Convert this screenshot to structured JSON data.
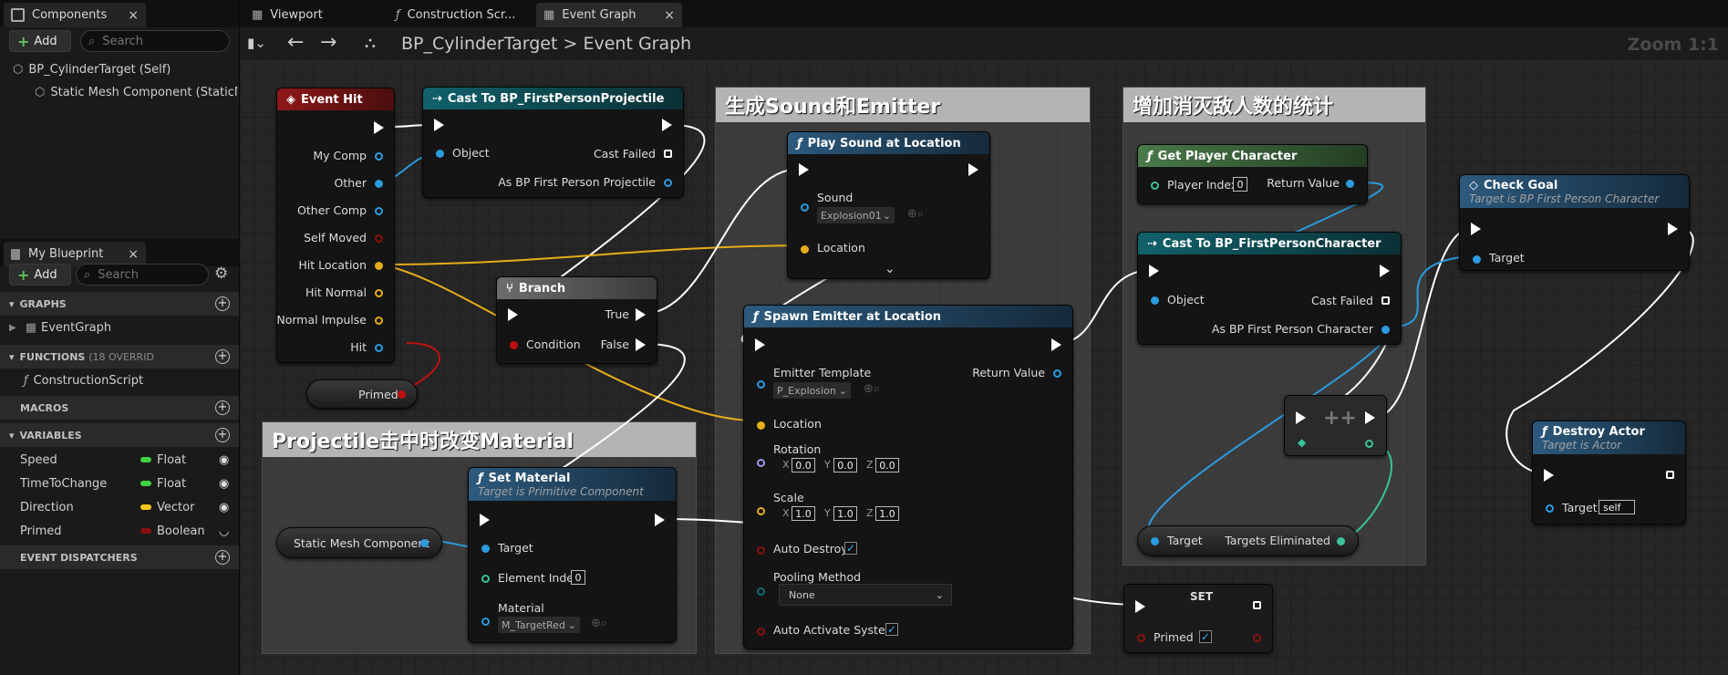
{
  "components_panel": {
    "tab_label": "Components",
    "close": "×",
    "add_label": "Add",
    "search_placeholder": "Search",
    "tree": [
      "BP_CylinderTarget (Self)",
      "Static Mesh Component (StaticMe"
    ]
  },
  "my_blueprint": {
    "tab_label": "My Blueprint",
    "close": "×",
    "add_label": "Add",
    "search_placeholder": "Search",
    "sections": {
      "graphs": "GRAPHS",
      "graph_item": "EventGraph",
      "functions": "FUNCTIONS",
      "functions_note": "(18 OVERRID",
      "function_item": "ConstructionScript",
      "macros": "MACROS",
      "variables": "VARIABLES",
      "dispatchers": "EVENT DISPATCHERS"
    },
    "variables": [
      {
        "name": "Speed",
        "type": "Float",
        "color": "#3fd23f"
      },
      {
        "name": "TimeToChange",
        "type": "Float",
        "color": "#3fd23f"
      },
      {
        "name": "Direction",
        "type": "Vector",
        "color": "#f5c518"
      },
      {
        "name": "Primed",
        "type": "Boolean",
        "color": "#8b0f0f"
      }
    ]
  },
  "editor_tabs": [
    "Viewport",
    "Construction Scr...",
    "Event Graph"
  ],
  "breadcrumb": {
    "blueprint": "BP_CylinderTarget",
    "sep": ">",
    "graph": "Event Graph"
  },
  "zoom": "Zoom 1:1",
  "comments": {
    "sound": "生成Sound和Emitter",
    "stats": "增加消灭敌人数的统计",
    "material": "Projectile击中时改变Material"
  },
  "nodes": {
    "event_hit": {
      "title": "Event Hit",
      "pins": [
        "My Comp",
        "Other",
        "Other Comp",
        "Self Moved",
        "Hit Location",
        "Hit Normal",
        "Normal Impulse",
        "Hit"
      ]
    },
    "cast_proj": {
      "title": "Cast To BP_FirstPersonProjectile",
      "object": "Object",
      "cast_failed": "Cast Failed",
      "as": "As BP First Person Projectile"
    },
    "branch": {
      "title": "Branch",
      "condition": "Condition",
      "true": "True",
      "false": "False"
    },
    "primed_get": {
      "label": "Primed"
    },
    "play_sound": {
      "title": "Play Sound at Location",
      "sound": "Sound",
      "sound_value": "Explosion01",
      "location": "Location"
    },
    "spawn_emitter": {
      "title": "Spawn Emitter at Location",
      "template": "Emitter Template",
      "template_value": "P_Explosion",
      "return": "Return Value",
      "location": "Location",
      "rotation": "Rotation",
      "rot": [
        "0.0",
        "0.0",
        "0.0"
      ],
      "scale": "Scale",
      "scl": [
        "1.0",
        "1.0",
        "1.0"
      ],
      "auto_destroy": "Auto Destroy",
      "pooling": "Pooling Method",
      "pooling_value": "None",
      "auto_activate": "Auto Activate System",
      "axes": [
        "X",
        "Y",
        "Z"
      ]
    },
    "set_material": {
      "title": "Set Material",
      "subtitle": "Target is Primitive Component",
      "target": "Target",
      "element_index": "Element Index",
      "index_value": "0",
      "material": "Material",
      "material_value": "M_TargetRed"
    },
    "static_mesh": {
      "label": "Static Mesh Component"
    },
    "get_player": {
      "title": "Get Player Character",
      "player_index": "Player Index",
      "index_value": "0",
      "return": "Return Value"
    },
    "cast_char": {
      "title": "Cast To BP_FirstPersonCharacter",
      "object": "Object",
      "cast_failed": "Cast Failed",
      "as": "As BP First Person Character"
    },
    "increment": {
      "label": "++"
    },
    "targets_get": {
      "target": "Target",
      "value": "Targets Eliminated"
    },
    "set_node": {
      "title": "SET",
      "primed": "Primed"
    },
    "check_goal": {
      "title": "Check Goal",
      "subtitle": "Target is BP First Person Character",
      "target": "Target"
    },
    "destroy_actor": {
      "title": "Destroy Actor",
      "subtitle": "Target is Actor",
      "target": "Target",
      "target_value": "self"
    }
  }
}
